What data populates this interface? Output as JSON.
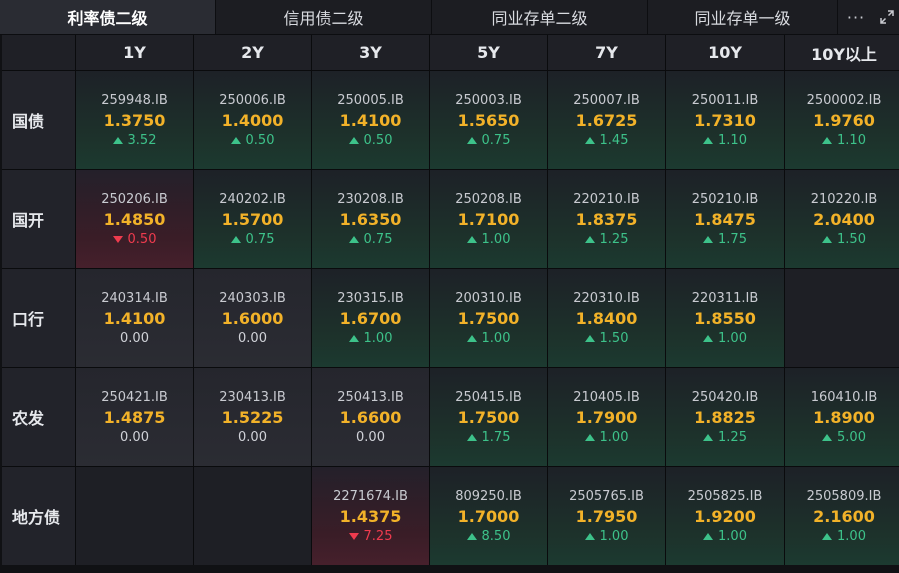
{
  "tabs": [
    {
      "label": "利率债二级",
      "active": true
    },
    {
      "label": "信用债二级",
      "active": false
    },
    {
      "label": "同业存单二级",
      "active": false
    },
    {
      "label": "同业存单一级",
      "active": false
    }
  ],
  "more_label": "···",
  "columns": [
    "1Y",
    "2Y",
    "3Y",
    "5Y",
    "7Y",
    "10Y",
    "10Y以上"
  ],
  "colors": {
    "up": "#3dc28a",
    "down": "#ef3b4e",
    "rate": "#f2b229"
  },
  "rows": [
    {
      "label": "国债",
      "cells": [
        {
          "code": "259948.IB",
          "rate": "1.3750",
          "change": "3.52",
          "dir": "up"
        },
        {
          "code": "250006.IB",
          "rate": "1.4000",
          "change": "0.50",
          "dir": "up"
        },
        {
          "code": "250005.IB",
          "rate": "1.4100",
          "change": "0.50",
          "dir": "up"
        },
        {
          "code": "250003.IB",
          "rate": "1.5650",
          "change": "0.75",
          "dir": "up"
        },
        {
          "code": "250007.IB",
          "rate": "1.6725",
          "change": "1.45",
          "dir": "up"
        },
        {
          "code": "250011.IB",
          "rate": "1.7310",
          "change": "1.10",
          "dir": "up"
        },
        {
          "code": "2500002.IB",
          "rate": "1.9760",
          "change": "1.10",
          "dir": "up"
        }
      ]
    },
    {
      "label": "国开",
      "cells": [
        {
          "code": "250206.IB",
          "rate": "1.4850",
          "change": "0.50",
          "dir": "down"
        },
        {
          "code": "240202.IB",
          "rate": "1.5700",
          "change": "0.75",
          "dir": "up"
        },
        {
          "code": "230208.IB",
          "rate": "1.6350",
          "change": "0.75",
          "dir": "up"
        },
        {
          "code": "250208.IB",
          "rate": "1.7100",
          "change": "1.00",
          "dir": "up"
        },
        {
          "code": "220210.IB",
          "rate": "1.8375",
          "change": "1.25",
          "dir": "up"
        },
        {
          "code": "250210.IB",
          "rate": "1.8475",
          "change": "1.75",
          "dir": "up"
        },
        {
          "code": "210220.IB",
          "rate": "2.0400",
          "change": "1.50",
          "dir": "up"
        }
      ]
    },
    {
      "label": "口行",
      "cells": [
        {
          "code": "240314.IB",
          "rate": "1.4100",
          "change": "0.00",
          "dir": "flat"
        },
        {
          "code": "240303.IB",
          "rate": "1.6000",
          "change": "0.00",
          "dir": "flat"
        },
        {
          "code": "230315.IB",
          "rate": "1.6700",
          "change": "1.00",
          "dir": "up"
        },
        {
          "code": "200310.IB",
          "rate": "1.7500",
          "change": "1.00",
          "dir": "up"
        },
        {
          "code": "220310.IB",
          "rate": "1.8400",
          "change": "1.50",
          "dir": "up"
        },
        {
          "code": "220311.IB",
          "rate": "1.8550",
          "change": "1.00",
          "dir": "up"
        },
        null
      ]
    },
    {
      "label": "农发",
      "cells": [
        {
          "code": "250421.IB",
          "rate": "1.4875",
          "change": "0.00",
          "dir": "flat"
        },
        {
          "code": "230413.IB",
          "rate": "1.5225",
          "change": "0.00",
          "dir": "flat"
        },
        {
          "code": "250413.IB",
          "rate": "1.6600",
          "change": "0.00",
          "dir": "flat"
        },
        {
          "code": "250415.IB",
          "rate": "1.7500",
          "change": "1.75",
          "dir": "up"
        },
        {
          "code": "210405.IB",
          "rate": "1.7900",
          "change": "1.00",
          "dir": "up"
        },
        {
          "code": "250420.IB",
          "rate": "1.8825",
          "change": "1.25",
          "dir": "up"
        },
        {
          "code": "160410.IB",
          "rate": "1.8900",
          "change": "5.00",
          "dir": "up"
        }
      ]
    },
    {
      "label": "地方债",
      "cells": [
        null,
        null,
        {
          "code": "2271674.IB",
          "rate": "1.4375",
          "change": "7.25",
          "dir": "down"
        },
        {
          "code": "809250.IB",
          "rate": "1.7000",
          "change": "8.50",
          "dir": "up"
        },
        {
          "code": "2505765.IB",
          "rate": "1.7950",
          "change": "1.00",
          "dir": "up"
        },
        {
          "code": "2505825.IB",
          "rate": "1.9200",
          "change": "1.00",
          "dir": "up"
        },
        {
          "code": "2505809.IB",
          "rate": "2.1600",
          "change": "1.00",
          "dir": "up"
        }
      ]
    }
  ]
}
